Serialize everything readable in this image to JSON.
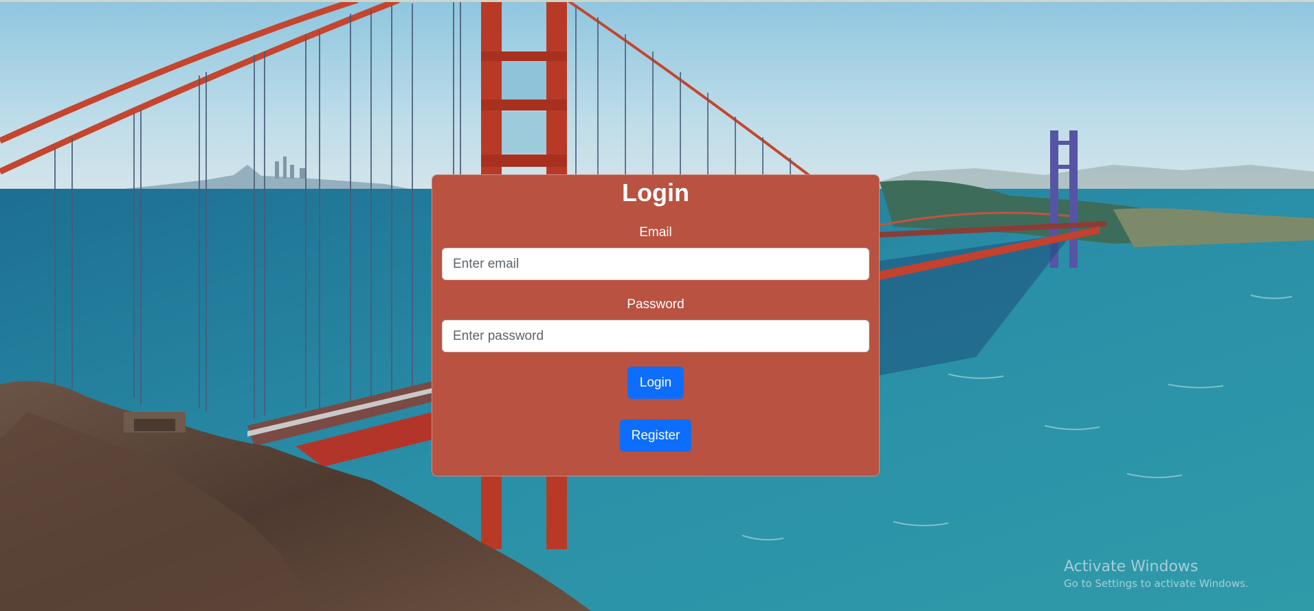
{
  "background": {
    "scene": "golden-gate-bridge-photo",
    "colors": {
      "sky": "#b9dbea",
      "water": "#2a8fa8",
      "bridge": "#c8372a",
      "cliff": "#5a4438"
    }
  },
  "login": {
    "title": "Login",
    "email_label": "Email",
    "email_placeholder": "Enter email",
    "email_value": "",
    "password_label": "Password",
    "password_placeholder": "Enter password",
    "password_value": "",
    "login_button": "Login",
    "register_button": "Register",
    "card_color": "#b95241",
    "button_color": "#0d6efd"
  },
  "watermark": {
    "title": "Activate Windows",
    "subtitle": "Go to Settings to activate Windows."
  }
}
